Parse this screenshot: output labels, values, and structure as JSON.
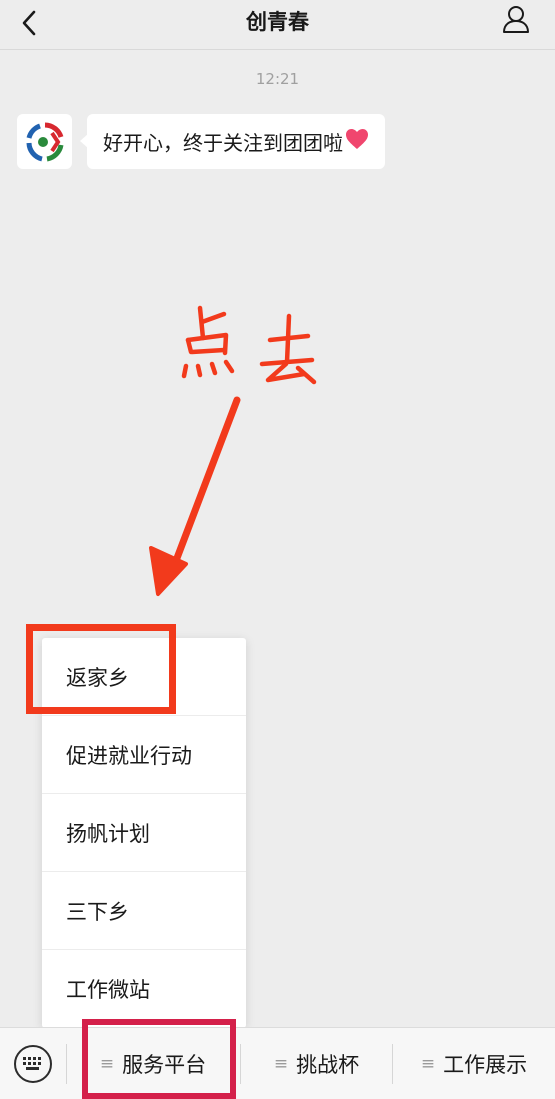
{
  "header": {
    "title": "创青春",
    "back_icon": "chevron-left-icon",
    "profile_icon": "person-icon"
  },
  "chat": {
    "timestamp": "12:21",
    "message": "好开心，终于关注到团团啦",
    "message_emoji": "heart-emoji"
  },
  "annotation": {
    "handwritten_text": "点去",
    "color": "#f23a1c"
  },
  "popup_menu": {
    "items": [
      {
        "label": "返家乡"
      },
      {
        "label": "促进就业行动"
      },
      {
        "label": "扬帆计划"
      },
      {
        "label": "三下乡"
      },
      {
        "label": "工作微站"
      }
    ]
  },
  "bottom_bar": {
    "keyboard_icon": "keyboard-icon",
    "tabs": [
      {
        "label": "服务平台"
      },
      {
        "label": "挑战杯"
      },
      {
        "label": "工作展示"
      }
    ],
    "highlight_color": "#d4204a"
  }
}
